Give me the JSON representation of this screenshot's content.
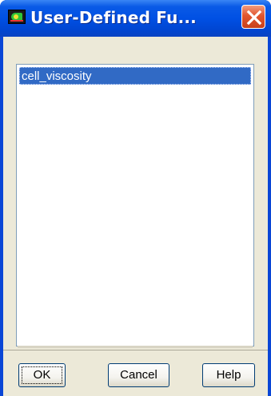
{
  "window": {
    "title": "User-Defined Fu...",
    "icon": "fluent-app-icon",
    "close_icon": "close-icon"
  },
  "list": {
    "items": [
      {
        "label": "cell_viscosity",
        "selected": true
      }
    ]
  },
  "buttons": {
    "ok": "OK",
    "cancel": "Cancel",
    "help": "Help"
  },
  "colors": {
    "titlebar": "#0050e4",
    "selection": "#316ac5",
    "dialog_bg": "#ece9d8",
    "close_button": "#e2552e"
  }
}
